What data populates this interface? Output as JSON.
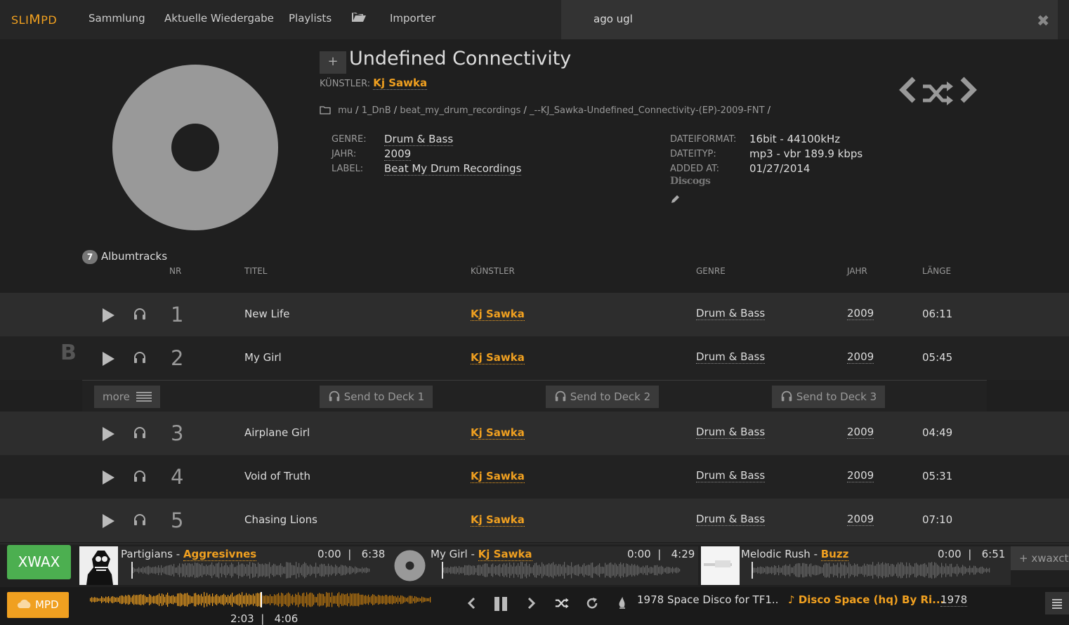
{
  "nav": {
    "logo_a": "SLI",
    "logo_b": "M",
    "logo_c": "PD",
    "items": [
      "Sammlung",
      "Aktuelle Wiedergabe",
      "Playlists",
      "Importer"
    ],
    "search_value": "ago ugl"
  },
  "album": {
    "title": "Undefined Connectivity",
    "artist_label": "KÜNSTLER:",
    "artist": "Kj Sawka",
    "path": [
      "mu",
      "1_DnB",
      "beat_my_drum_recordings",
      "_--KJ_Sawka-Undefined_Connectivity-(EP)-2009-FNT"
    ],
    "meta_left": [
      {
        "label": "GENRE:",
        "value": "Drum & Bass"
      },
      {
        "label": "JAHR:",
        "value": "2009"
      },
      {
        "label": "LABEL:",
        "value": "Beat My Drum Recordings"
      }
    ],
    "meta_right": [
      {
        "label": "DATEIFORMAT:",
        "value": "16bit - 44100kHz"
      },
      {
        "label": "DATEITYP:",
        "value": "mp3 - vbr 189.9 kbps"
      },
      {
        "label": "ADDED AT:",
        "value": "01/27/2014"
      }
    ],
    "discogs": "Discogs"
  },
  "tracklist": {
    "count": "7",
    "label": "Albumtracks",
    "columns": [
      "NR",
      "TITEL",
      "KÜNSTLER",
      "GENRE",
      "JAHR",
      "LÄNGE"
    ],
    "rows": [
      {
        "nr": "1",
        "title": "New Life",
        "artist": "Kj Sawka",
        "genre": "Drum & Bass",
        "year": "2009",
        "length": "06:11"
      },
      {
        "nr": "2",
        "title": "My Girl",
        "artist": "Kj Sawka",
        "genre": "Drum & Bass",
        "year": "2009",
        "length": "05:45"
      },
      {
        "nr": "3",
        "title": "Airplane Girl",
        "artist": "Kj Sawka",
        "genre": "Drum & Bass",
        "year": "2009",
        "length": "04:49"
      },
      {
        "nr": "4",
        "title": "Void of Truth",
        "artist": "Kj Sawka",
        "genre": "Drum & Bass",
        "year": "2009",
        "length": "05:31"
      },
      {
        "nr": "5",
        "title": "Chasing Lions",
        "artist": "Kj Sawka",
        "genre": "Drum & Bass",
        "year": "2009",
        "length": "07:10"
      }
    ],
    "marker": "B",
    "actions": {
      "more": "more",
      "deck1": "Send to Deck 1",
      "deck2": "Send to Deck 2",
      "deck3": "Send to Deck 3"
    }
  },
  "decks": {
    "xwax_label": "XWAX",
    "xwaxctl_label": "xwaxctr",
    "items": [
      {
        "title": "Partigians",
        "artist": "Aggresivnes",
        "time": "0:00",
        "length": "6:38"
      },
      {
        "title": "My Girl",
        "artist": "Kj Sawka",
        "time": "0:00",
        "length": "4:29"
      },
      {
        "title": "Melodic Rush",
        "artist": "Buzz",
        "time": "0:00",
        "length": "6:51"
      }
    ]
  },
  "player": {
    "mpd_label": "MPD",
    "elapsed": "2:03",
    "total": "4:06",
    "progress": 0.5,
    "now_playing_title": "1978 Space Disco for TF1..",
    "now_playing_artist": "♪ Disco Space (hq) By Ri...",
    "now_playing_year": "1978"
  },
  "colors": {
    "accent": "#f0a020",
    "xwax": "#4caf50",
    "row_odd": "#2d2d2d",
    "row_even": "#222222"
  }
}
